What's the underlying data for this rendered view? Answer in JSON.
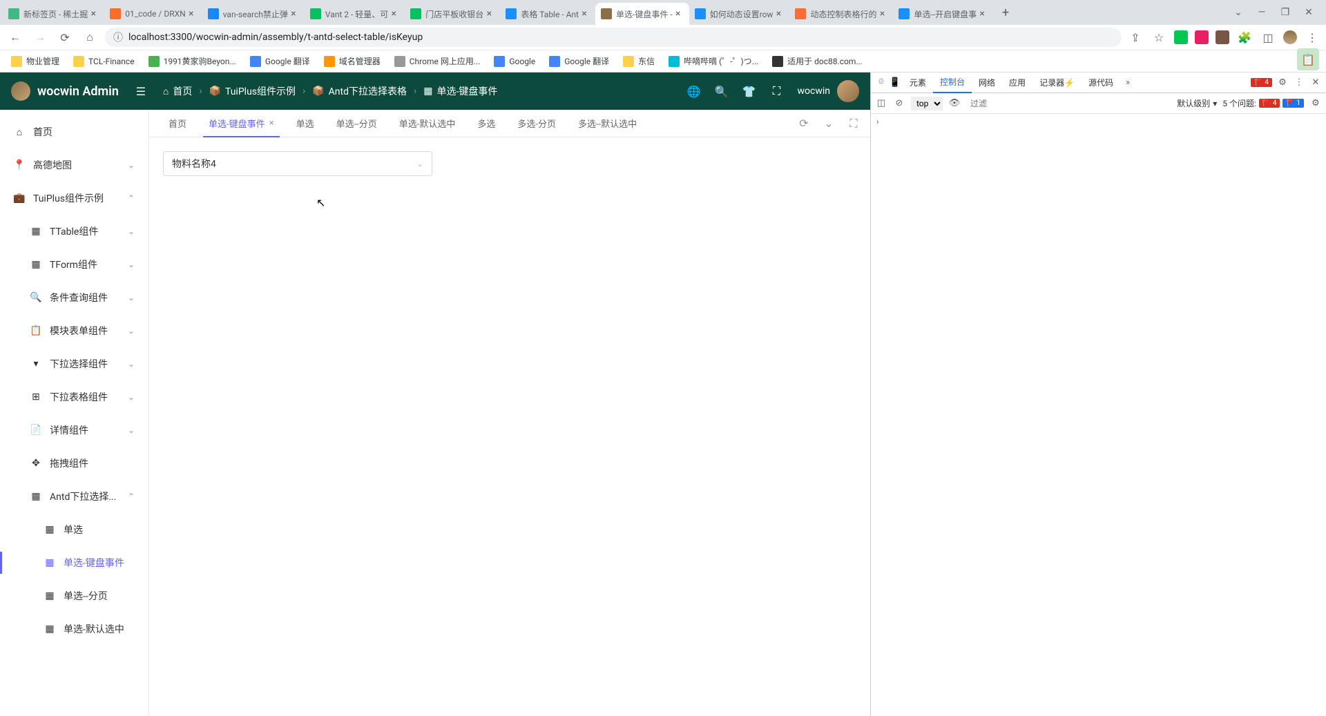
{
  "browser": {
    "tabs": [
      {
        "title": "新标签页 - 稀土掘",
        "active": false
      },
      {
        "title": "01_code / DRXN",
        "active": false
      },
      {
        "title": "van-search禁止弹",
        "active": false
      },
      {
        "title": "Vant 2 - 轻量、可",
        "active": false
      },
      {
        "title": "门店平板收银台",
        "active": false
      },
      {
        "title": "表格 Table - Ant",
        "active": false
      },
      {
        "title": "单选-键盘事件 -",
        "active": true
      },
      {
        "title": "如何动态设置row",
        "active": false
      },
      {
        "title": "动态控制表格行的",
        "active": false
      },
      {
        "title": "单选--开启键盘事",
        "active": false
      }
    ],
    "url": "localhost:3300/wocwin-admin/assembly/t-antd-select-table/isKeyup",
    "bookmarks": [
      {
        "title": "物业管理",
        "color": "#ffd04c"
      },
      {
        "title": "TCL-Finance",
        "color": "#ffd04c"
      },
      {
        "title": "1991黄家驹Beyon...",
        "color": "#4caf50"
      },
      {
        "title": "Google 翻译",
        "color": "#4285f4"
      },
      {
        "title": "域名管理器",
        "color": "#ff9800"
      },
      {
        "title": "Chrome 网上应用...",
        "color": "#999"
      },
      {
        "title": "Google",
        "color": "#4285f4"
      },
      {
        "title": "Google 翻译",
        "color": "#4285f4"
      },
      {
        "title": "东信",
        "color": "#ffd04c"
      },
      {
        "title": "哔嘀哔嘀 (゜-゜)つ...",
        "color": "#00bcd4"
      },
      {
        "title": "适用于 doc88.com...",
        "color": "#333"
      }
    ]
  },
  "app": {
    "title": "wocwin Admin",
    "breadcrumb": [
      {
        "icon": "home",
        "label": "首页"
      },
      {
        "icon": "box",
        "label": "TuiPlus组件示例"
      },
      {
        "icon": "box",
        "label": "Antd下拉选择表格"
      },
      {
        "icon": "grid",
        "label": "单选-键盘事件"
      }
    ],
    "username": "wocwin"
  },
  "sidebar": {
    "items": [
      {
        "label": "首页",
        "icon": "home",
        "level": 0,
        "expand": null,
        "active": false
      },
      {
        "label": "高德地图",
        "icon": "map",
        "level": 0,
        "expand": "down",
        "active": false
      },
      {
        "label": "TuiPlus组件示例",
        "icon": "box",
        "level": 0,
        "expand": "up",
        "active": false
      },
      {
        "label": "TTable组件",
        "icon": "grid",
        "level": 1,
        "expand": "down",
        "active": false
      },
      {
        "label": "TForm组件",
        "icon": "grid",
        "level": 1,
        "expand": "down",
        "active": false
      },
      {
        "label": "条件查询组件",
        "icon": "search",
        "level": 1,
        "expand": "down",
        "active": false
      },
      {
        "label": "模块表单组件",
        "icon": "form",
        "level": 1,
        "expand": "down",
        "active": false
      },
      {
        "label": "下拉选择组件",
        "icon": "select",
        "level": 1,
        "expand": "down",
        "active": false
      },
      {
        "label": "下拉表格组件",
        "icon": "table",
        "level": 1,
        "expand": "down",
        "active": false
      },
      {
        "label": "详情组件",
        "icon": "detail",
        "level": 1,
        "expand": "down",
        "active": false
      },
      {
        "label": "拖拽组件",
        "icon": "drag",
        "level": 1,
        "expand": null,
        "active": false
      },
      {
        "label": "Antd下拉选择...",
        "icon": "grid",
        "level": 1,
        "expand": "up",
        "active": false
      },
      {
        "label": "单选",
        "icon": "grid",
        "level": 2,
        "expand": null,
        "active": false
      },
      {
        "label": "单选-键盘事件",
        "icon": "grid",
        "level": 2,
        "expand": null,
        "active": true
      },
      {
        "label": "单选--分页",
        "icon": "grid",
        "level": 2,
        "expand": null,
        "active": false
      },
      {
        "label": "单选-默认选中",
        "icon": "grid",
        "level": 2,
        "expand": null,
        "active": false
      }
    ]
  },
  "pageTabs": [
    {
      "label": "首页",
      "active": false,
      "closable": false
    },
    {
      "label": "单选-键盘事件",
      "active": true,
      "closable": true
    },
    {
      "label": "单选",
      "active": false,
      "closable": false
    },
    {
      "label": "单选--分页",
      "active": false,
      "closable": false
    },
    {
      "label": "单选-默认选中",
      "active": false,
      "closable": false
    },
    {
      "label": "多选",
      "active": false,
      "closable": false
    },
    {
      "label": "多选-分页",
      "active": false,
      "closable": false
    },
    {
      "label": "多选--默认选中",
      "active": false,
      "closable": false
    }
  ],
  "select": {
    "value": "物料名称4"
  },
  "devtools": {
    "tabs": [
      "元素",
      "控制台",
      "网络",
      "应用",
      "记录器",
      "源代码"
    ],
    "activeTab": "控制台",
    "recorderBadge": "⚡",
    "errorCount": "4",
    "context": "top",
    "filterPlaceholder": "过滤",
    "levelLabel": "默认级别",
    "issuesLabel": "5 个问题:",
    "issuesRed": "4",
    "issuesBlue": "1"
  }
}
